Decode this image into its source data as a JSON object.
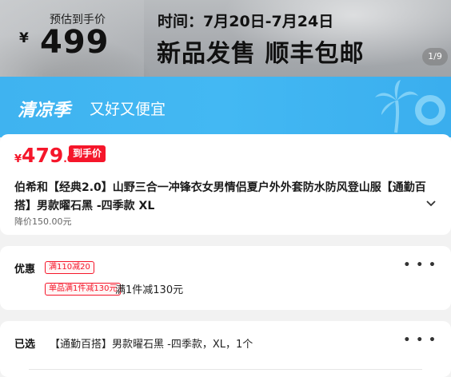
{
  "hero": {
    "est_label": "预估到手价",
    "currency": "¥",
    "price": "499",
    "time": "时间：7月20日-7月24日",
    "slogan": "新品发售 顺丰包邮",
    "pager": "1/9"
  },
  "season": {
    "title": "清凉季",
    "subtitle": "又好又便宜"
  },
  "product": {
    "currency": "¥",
    "price_int": "479",
    "price_dec": ".00",
    "price_badge": "到手价",
    "title": "伯希和【经典2.0】山野三合一冲锋衣女男情侣夏户外外套防水防风登山服【通勤百搭】男款曜石黑 -四季款 XL",
    "original_price": "降价150.00元"
  },
  "promo": {
    "label": "优惠",
    "coupon": "满110减20",
    "single_tag": "单品满1件减130元",
    "single_text": "满1件减130元",
    "more": "• • •"
  },
  "selected": {
    "label": "已选",
    "value": "【通勤百搭】男款曜石黑 -四季款，XL，1个",
    "more": "• • •"
  },
  "colors": {
    "accent_red": "#f5162a",
    "season_blue": "#43b8f3"
  },
  "icons": [
    "palm-tree-icon",
    "swim-ring-icon",
    "chevron-down-icon",
    "more-dots-icon"
  ]
}
